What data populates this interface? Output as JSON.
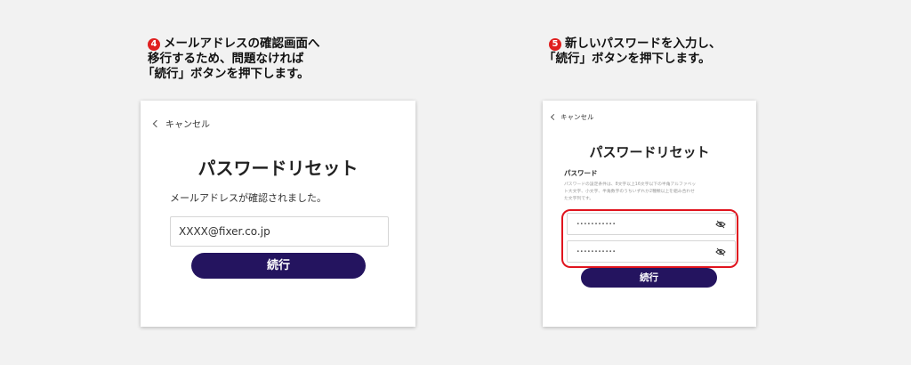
{
  "step4": {
    "number": "4",
    "lines": [
      "メールアドレスの確認画面へ",
      "移行するため、問題なければ",
      "「続行」ボタンを押下します。"
    ]
  },
  "step5": {
    "number": "5",
    "lines": [
      "新しいパスワードを入力し、",
      "「続行」ボタンを押下します。"
    ]
  },
  "left_panel": {
    "cancel_label": "キャンセル",
    "title": "パスワードリセット",
    "message": "メールアドレスが確認されました。",
    "email_value": "XXXX@fixer.co.jp",
    "continue_label": "続行"
  },
  "right_panel": {
    "cancel_label": "キャンセル",
    "title": "パスワードリセット",
    "password_label": "パスワード",
    "hint_line1": "パスワードの設定条件は、8文字以上16文字以下の半角アルファベッ",
    "hint_line2": "ト大文字、小文字、半角数字のうちいずれか2種類以上を組み合わせ",
    "hint_line3": "た文字列です。",
    "password_mask": "•••••••••••",
    "confirm_mask": "•••••••••••",
    "continue_label": "続行",
    "highlight_color": "#e0141e"
  }
}
